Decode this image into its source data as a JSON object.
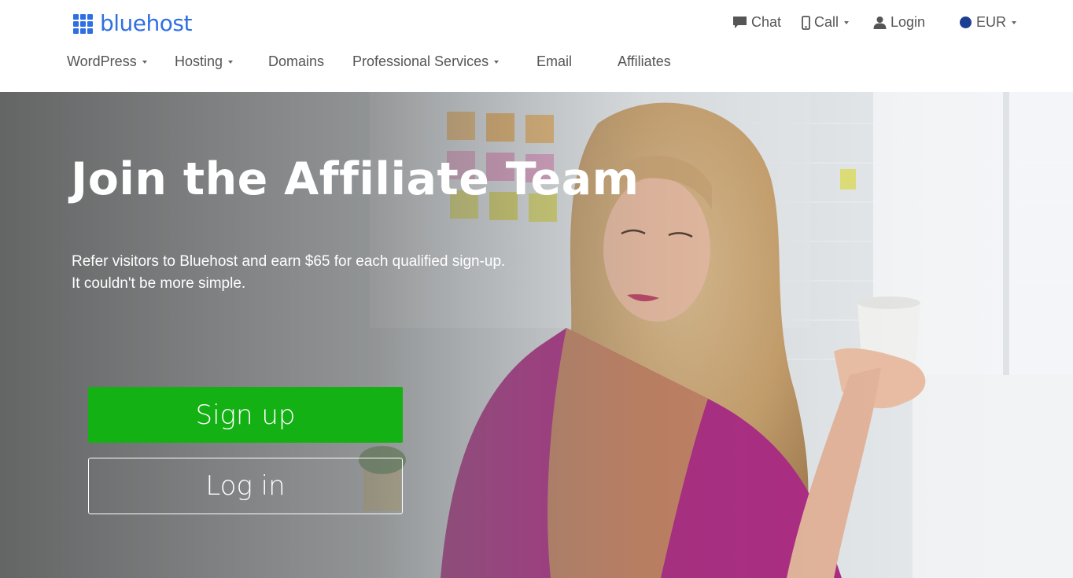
{
  "brand": {
    "name": "bluehost",
    "color": "#2f6fe4"
  },
  "utility_nav": {
    "chat": "Chat",
    "call": "Call",
    "login": "Login",
    "currency": "EUR"
  },
  "main_nav": {
    "items": [
      {
        "label": "WordPress",
        "has_dropdown": true
      },
      {
        "label": "Hosting",
        "has_dropdown": true
      },
      {
        "label": "Domains",
        "has_dropdown": false
      },
      {
        "label": "Professional Services",
        "has_dropdown": true
      },
      {
        "label": "Email",
        "has_dropdown": false
      },
      {
        "label": "Affiliates",
        "has_dropdown": false
      }
    ]
  },
  "hero": {
    "title": "Join the Affiliate Team",
    "subtitle_line1": "Refer visitors to Bluehost and earn $65 for each qualified sign-up.",
    "subtitle_line2": "It couldn't be more simple.",
    "signup_label": "Sign up",
    "login_label": "Log in",
    "signup_color": "#14b114"
  },
  "icons": {
    "chat": "chat-bubble-icon",
    "call": "mobile-phone-icon",
    "login": "user-icon",
    "currency": "globe-dot-icon"
  }
}
